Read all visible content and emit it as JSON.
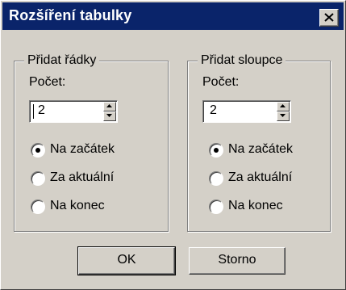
{
  "window": {
    "title": "Rozšíření tabulky"
  },
  "left_group": {
    "title": "Přidat řádky",
    "count_label": "Počet:",
    "count_value": "2",
    "options": [
      "Na začátek",
      "Za aktuální",
      "Na konec"
    ],
    "selected_index": 0
  },
  "right_group": {
    "title": "Přidat sloupce",
    "count_label": "Počet:",
    "count_value": "2",
    "options": [
      "Na začátek",
      "Za aktuální",
      "Na konec"
    ],
    "selected_index": 0
  },
  "buttons": {
    "ok": "OK",
    "cancel": "Storno"
  }
}
